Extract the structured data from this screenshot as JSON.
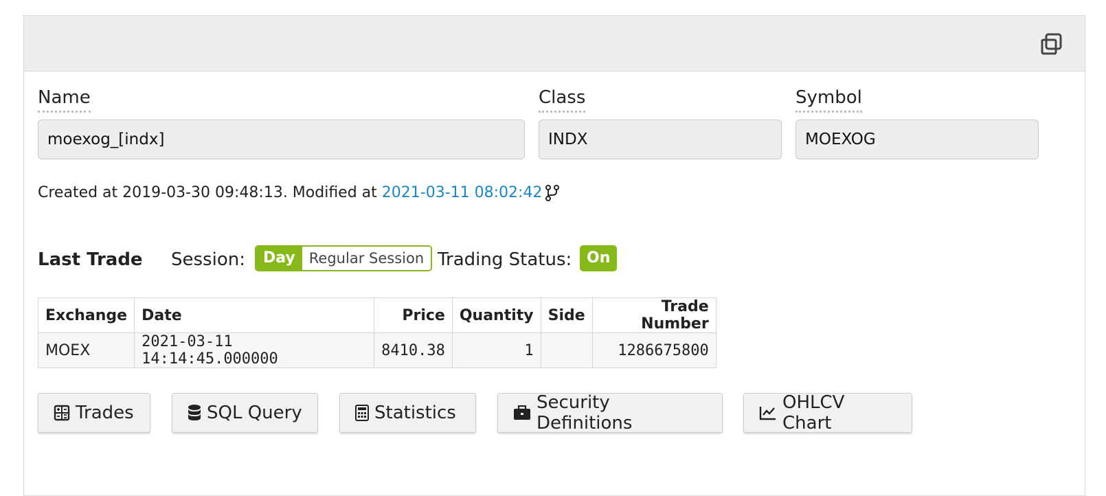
{
  "header": {
    "copy_icon": "copy-icon"
  },
  "fields": {
    "name": {
      "label": "Name",
      "value": "moexog_[indx]"
    },
    "class": {
      "label": "Class",
      "value": "INDX"
    },
    "symbol": {
      "label": "Symbol",
      "value": "MOEXOG"
    }
  },
  "meta": {
    "created_text": "Created at 2019-03-30 09:48:13. Modified at ",
    "modified_link": "2021-03-11 08:02:42"
  },
  "last_trade": {
    "title": "Last Trade",
    "session_label": "Session:",
    "session_day": "Day",
    "session_regular": "Regular Session",
    "status_label": "Trading Status:",
    "status_value": "On"
  },
  "table": {
    "headers": [
      "Exchange",
      "Date",
      "Price",
      "Quantity",
      "Side",
      "Trade Number"
    ],
    "row": [
      "MOEX",
      "2021-03-11 14:14:45.000000",
      "8410.38",
      "1",
      "",
      "1286675800"
    ]
  },
  "buttons": {
    "trades": "Trades",
    "sql": "SQL Query",
    "statistics": "Statistics",
    "definitions": "Security Definitions",
    "ohlcv": "OHLCV Chart"
  },
  "colors": {
    "accent_green": "#86b817",
    "link_blue": "#1a86c8"
  }
}
